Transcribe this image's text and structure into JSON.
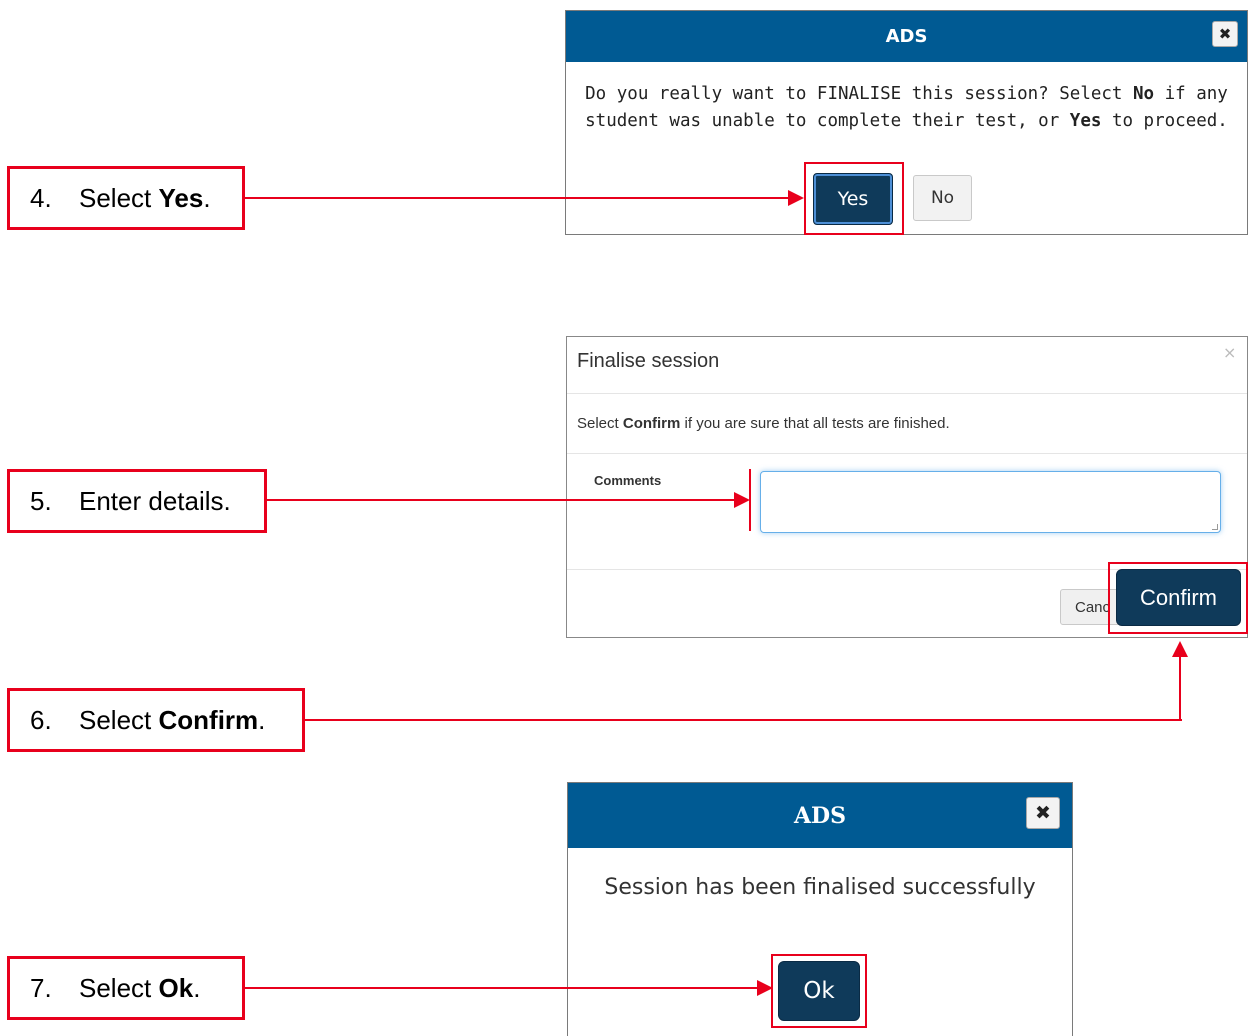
{
  "steps": [
    {
      "num": "4.",
      "prefix": "Select ",
      "bold": "Yes",
      "suffix": "."
    },
    {
      "num": "5.",
      "prefix": "Enter details.",
      "bold": "",
      "suffix": ""
    },
    {
      "num": "6.",
      "prefix": "Select ",
      "bold": "Confirm",
      "suffix": "."
    },
    {
      "num": "7.",
      "prefix": "Select ",
      "bold": "Ok",
      "suffix": "."
    }
  ],
  "dialog_finalise_confirm": {
    "title": "ADS",
    "close_icon": "close-icon",
    "message_part1": "Do you really want to FINALISE this session? Select ",
    "message_no": "No",
    "message_part2": " if any student was unable to complete their test, or ",
    "message_yes": "Yes",
    "message_part3": " to proceed.",
    "yes_label": "Yes",
    "no_label": "No"
  },
  "dialog_finalise_session": {
    "title": "Finalise session",
    "close_glyph": "×",
    "instruction_part1": "Select ",
    "instruction_bold": "Confirm",
    "instruction_part2": " if you are sure that all tests are finished.",
    "comments_label": "Comments",
    "comments_value": "",
    "cancel_label": "Canc",
    "confirm_label": "Confirm"
  },
  "dialog_success": {
    "title": "ADS",
    "close_icon": "close-icon",
    "message": "Session has been finalised successfully",
    "ok_label": "Ok"
  },
  "colors": {
    "header_blue": "#005a93",
    "primary_button": "#0f3a5a",
    "callout_red": "#e8001c"
  }
}
